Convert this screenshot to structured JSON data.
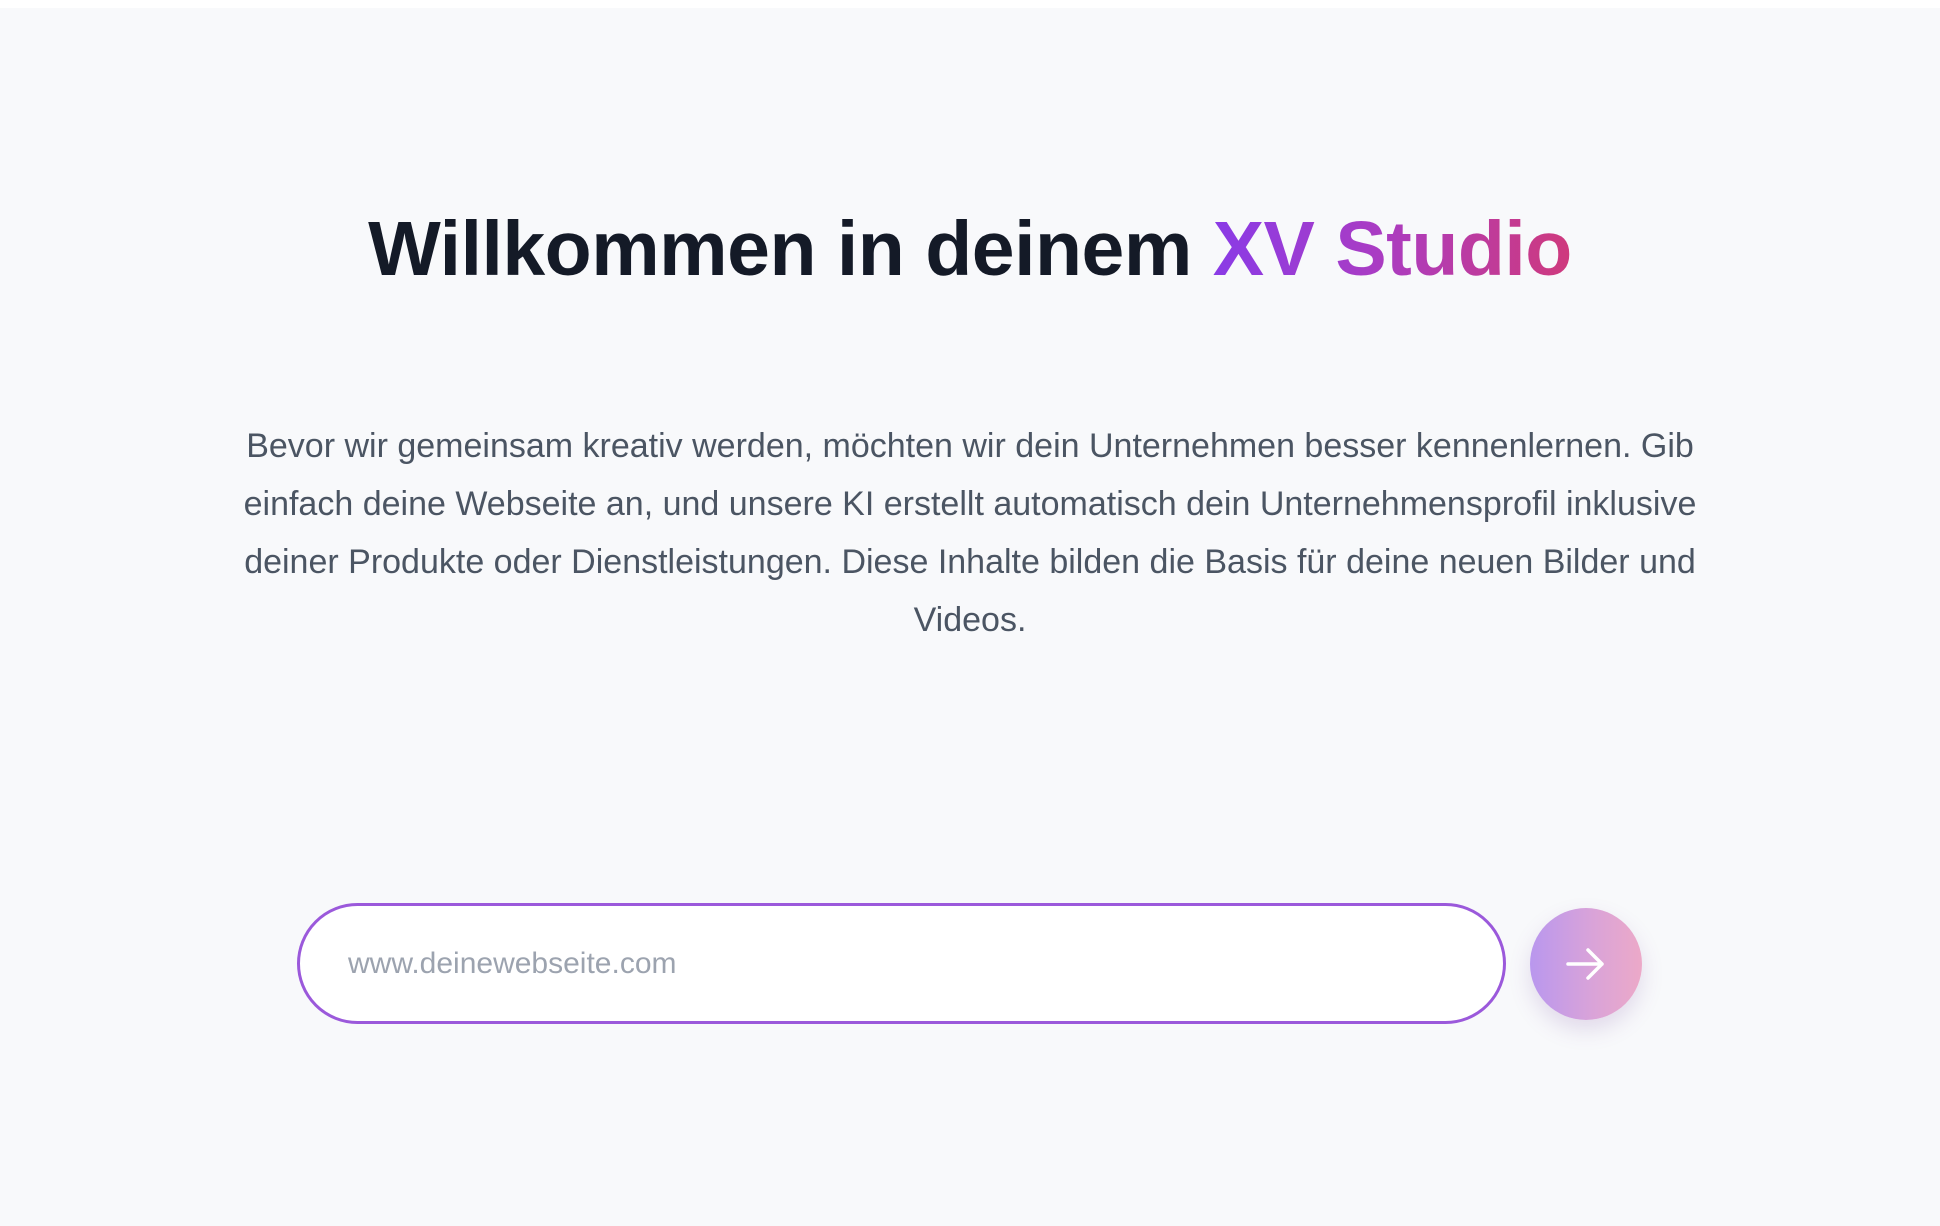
{
  "header": {
    "title_prefix": "Willkommen in deinem",
    "brand_part1": "XV",
    "brand_part2": "Studio",
    "brand_gradient": [
      "#8a3be6",
      "#cf3a7c"
    ]
  },
  "intro": {
    "text": "Bevor wir gemeinsam kreativ werden, möchten wir dein Unternehmen besser kennenlernen. Gib einfach deine Webseite an, und unsere KI erstellt automatisch dein Unternehmensprofil inklusive deiner Produkte oder Dienstleistungen. Diese Inhalte bilden die Basis für deine neuen Bilder und Videos."
  },
  "form": {
    "website_input": {
      "value": "",
      "placeholder": "www.deinewebseite.com"
    },
    "submit_icon": "arrow-right-icon",
    "accent_border": "#9b59db"
  }
}
